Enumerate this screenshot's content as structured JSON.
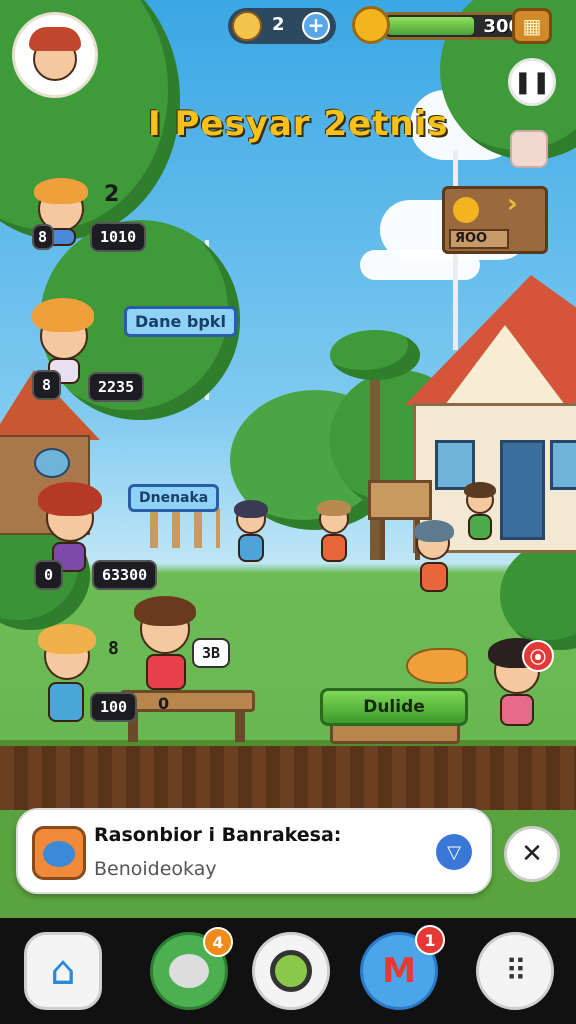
{
  "hud": {
    "friends_count": "2",
    "add_symbol": "+",
    "coin_value": "300",
    "energy_fill": 0.62,
    "title": "I Pesyar 2etnis"
  },
  "sign": {
    "label": "ЯOO"
  },
  "players": [
    {
      "rank": "2",
      "score_left": "8",
      "score": "1010"
    },
    {
      "score_left": "8",
      "score": "2235"
    },
    {
      "score_left": "0",
      "score": "63300"
    },
    {
      "score_left": "8",
      "score": "100"
    }
  ],
  "tags": {
    "bubble1": "Dane bpkl",
    "bubble2": "Dnenaka",
    "mid_left": "8",
    "mid_score": "3B",
    "bench_zero": "0"
  },
  "action_button": {
    "label": "Dulide"
  },
  "notification": {
    "title": "Rasonbior i Banrakesa:",
    "subtitle": "Benoideokay"
  },
  "nav": {
    "chat_badge": "4",
    "mail_badge": "1"
  },
  "colors": {
    "accent_green": "#58b83a",
    "badge_red": "#e53935",
    "title_yellow": "#f6c21a"
  }
}
